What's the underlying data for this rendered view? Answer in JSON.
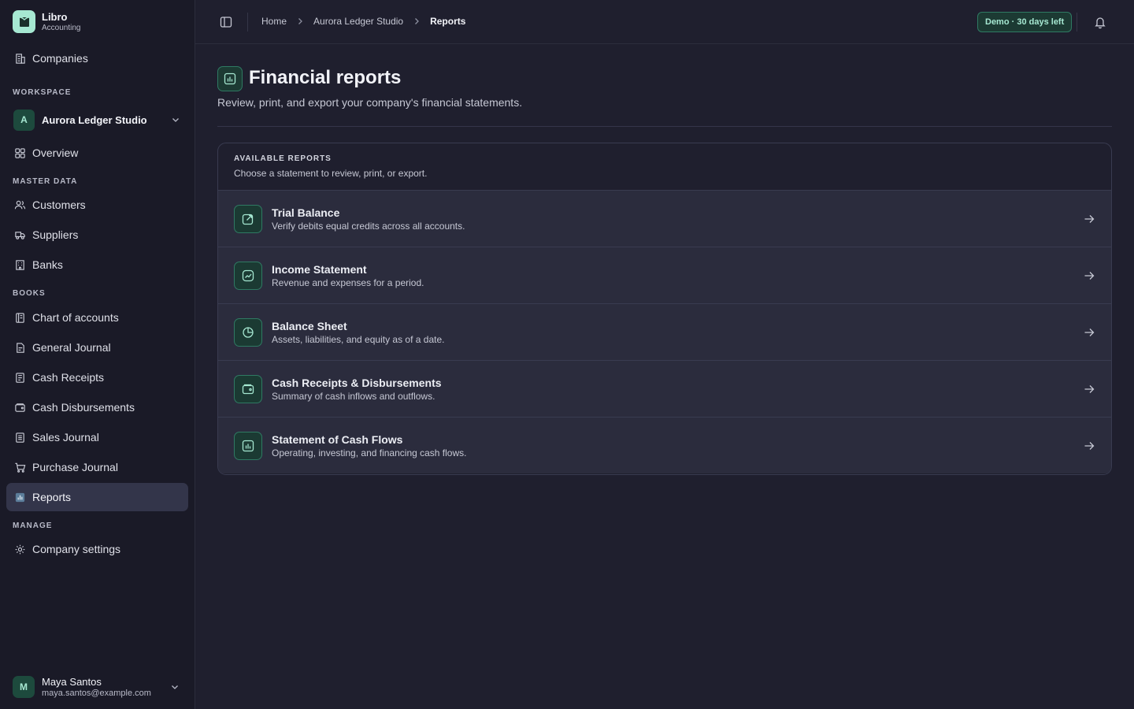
{
  "app": {
    "name": "Libro",
    "subtitle": "Accounting"
  },
  "sidebar": {
    "companies_label": "Companies",
    "sections": {
      "workspace": "WORKSPACE",
      "master_data": "MASTER DATA",
      "books": "BOOKS",
      "manage": "MANAGE"
    },
    "workspace": {
      "initial": "A",
      "name": "Aurora Ledger Studio"
    },
    "items": {
      "overview": "Overview",
      "customers": "Customers",
      "suppliers": "Suppliers",
      "banks": "Banks",
      "chart_of_accounts": "Chart of accounts",
      "general_journal": "General Journal",
      "cash_receipts": "Cash Receipts",
      "cash_disbursements": "Cash Disbursements",
      "sales_journal": "Sales Journal",
      "purchase_journal": "Purchase Journal",
      "reports": "Reports",
      "company_settings": "Company settings"
    },
    "active": "reports",
    "user": {
      "initial": "M",
      "name": "Maya Santos",
      "email": "maya.santos@example.com"
    }
  },
  "topbar": {
    "breadcrumbs": [
      "Home",
      "Aurora Ledger Studio",
      "Reports"
    ],
    "demo_badge": "Demo · 30 days left"
  },
  "page": {
    "title": "Financial reports",
    "description": "Review, print, and export your company's financial statements."
  },
  "reports_card": {
    "kicker": "AVAILABLE REPORTS",
    "subtitle": "Choose a statement to review, print, or export.",
    "items": [
      {
        "title": "Trial Balance",
        "desc": "Verify debits equal credits across all accounts.",
        "icon": "external-link-icon"
      },
      {
        "title": "Income Statement",
        "desc": "Revenue and expenses for a period.",
        "icon": "trend-up-icon"
      },
      {
        "title": "Balance Sheet",
        "desc": "Assets, liabilities, and equity as of a date.",
        "icon": "pie-chart-icon"
      },
      {
        "title": "Cash Receipts & Disbursements",
        "desc": "Summary of cash inflows and outflows.",
        "icon": "wallet-icon"
      },
      {
        "title": "Statement of Cash Flows",
        "desc": "Operating, investing, and financing cash flows.",
        "icon": "bar-chart-icon"
      }
    ]
  },
  "colors": {
    "accent": "#a6e8d2",
    "accent_border": "#2f7a63",
    "background": "#1f1f2e",
    "sidebar": "#1a1a27"
  }
}
